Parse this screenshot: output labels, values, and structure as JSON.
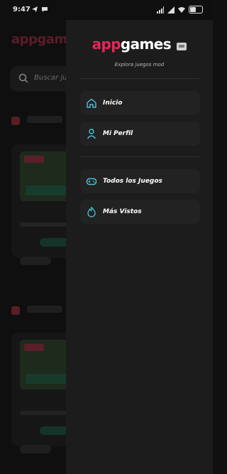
{
  "status_bar": {
    "time": "9:47",
    "icons": [
      "telegram-icon",
      "messages-icon",
      "signal-icon",
      "signal-icon",
      "wifi-icon",
      "battery-icon"
    ]
  },
  "background": {
    "logo": "appgames",
    "search_placeholder": "Buscar juegos..."
  },
  "drawer": {
    "brand_app": "app",
    "brand_games": "games",
    "subtitle": "Explora juegos mod",
    "items": [
      {
        "label": "Inicio",
        "icon": "home-icon"
      },
      {
        "label": "Mi Perfil",
        "icon": "user-icon"
      },
      {
        "label": "Todos los Juegos",
        "icon": "gamepad-icon"
      },
      {
        "label": "Más Vistos",
        "icon": "fire-icon"
      }
    ]
  },
  "colors": {
    "accent": "#4cc3d9",
    "brand_pink": "#e8255a",
    "drawer_bg": "#1c1c1c",
    "item_bg": "#222222"
  }
}
